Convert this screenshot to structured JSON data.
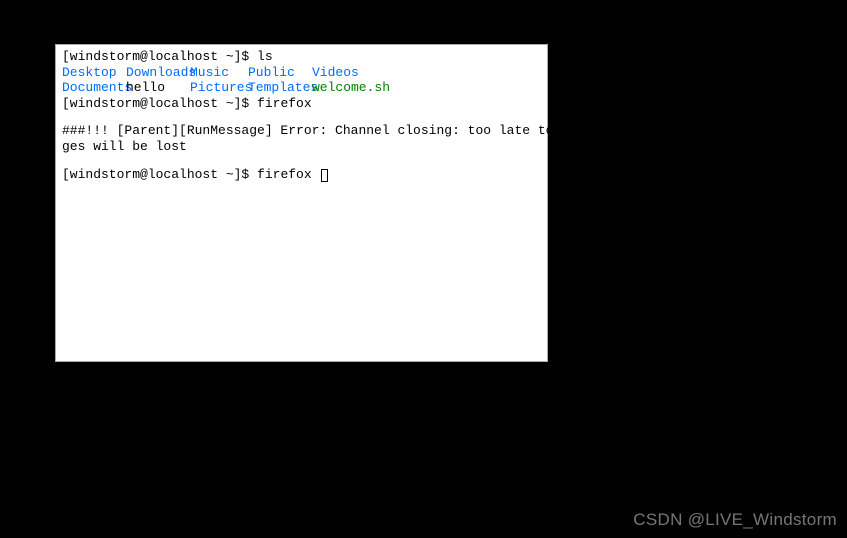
{
  "terminal": {
    "prompt": "[windstorm@localhost ~]$ ",
    "cmd_ls": "ls",
    "ls_output": {
      "row1": {
        "c1": "Desktop",
        "c2": "Downloads",
        "c3": "Music",
        "c4": "Public",
        "c5": "Videos"
      },
      "row2": {
        "c1": "Documents",
        "c2": "hello",
        "c3": "Pictures",
        "c4": "Templates",
        "c5": "welcome.sh"
      }
    },
    "cmd_firefox1": "firefox",
    "error_line1": "###!!! [Parent][RunMessage] Error: Channel closing: too late to send/recv, messa",
    "error_line2": "ges will be lost",
    "cmd_firefox2": "firefox "
  },
  "watermark": "CSDN @LIVE_Windstorm"
}
